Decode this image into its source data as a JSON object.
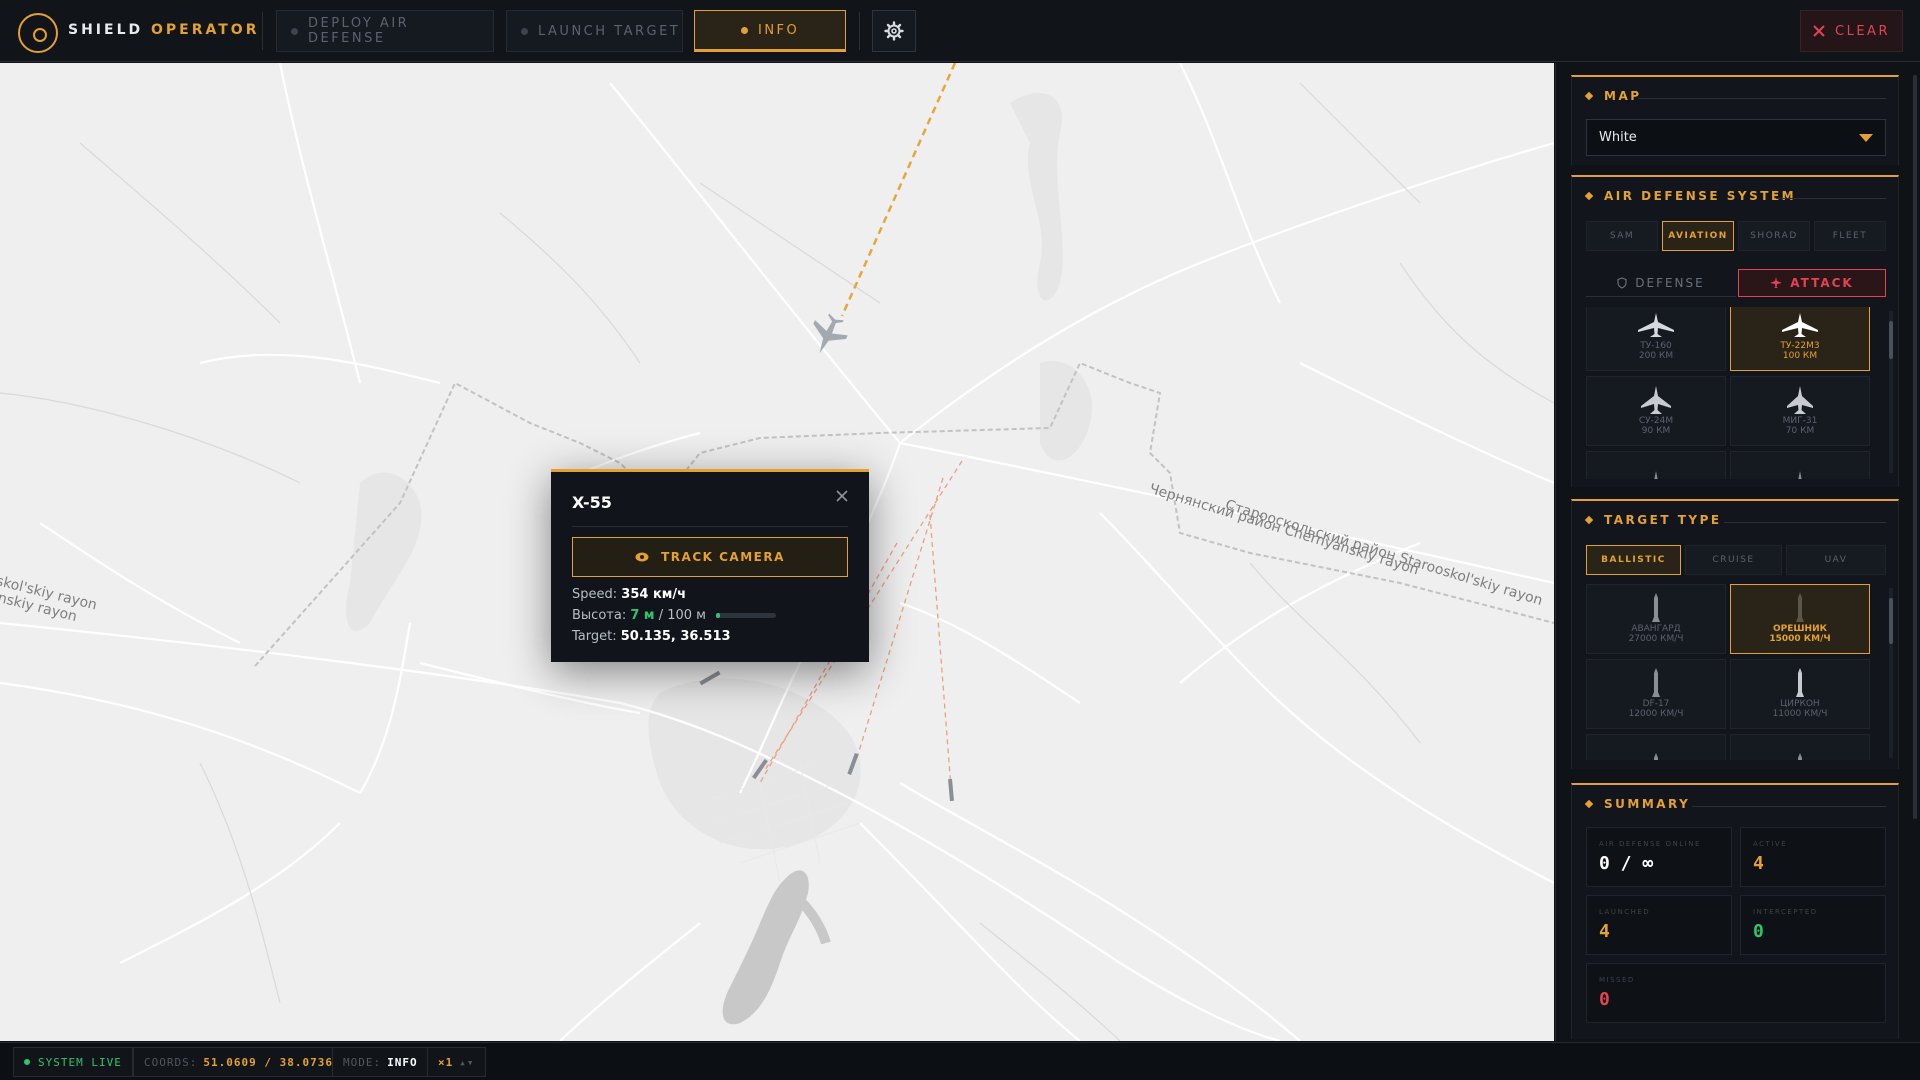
{
  "app": {
    "brand_primary": "SHIELD",
    "brand_secondary": "OPERATOR"
  },
  "toolbar": {
    "tabs": [
      {
        "label": "DEPLOY AIR DEFENSE",
        "active": false
      },
      {
        "label": "LAUNCH TARGET",
        "active": false
      },
      {
        "label": "INFO",
        "active": true
      }
    ],
    "settings_icon": "gear-icon",
    "clear_label": "CLEAR",
    "clear_icon": "close-icon"
  },
  "map": {
    "labels": {
      "left_region": "oskol'skiy rayon",
      "left_region2": "nskiy rayon",
      "right_region": "Старооскольский район Starooskol'skiy rayon",
      "right_region2": "Чернянский район Chernyanskiy rayon"
    }
  },
  "popup": {
    "title": "X-55",
    "close_icon": "close-icon",
    "track_label": "TRACK CAMERA",
    "speed_label": "Speed:",
    "speed_value": "354 км/ч",
    "altitude_label": "Высота:",
    "altitude_value": "7 м",
    "altitude_max": "/ 100 м",
    "altitude_fraction": 0.07,
    "target_label": "Target:",
    "target_value": "50.135, 36.513"
  },
  "panel": {
    "map_section": {
      "title": "MAP",
      "selected": "White"
    },
    "air_defense": {
      "title": "AIR DEFENSE SYSTEM",
      "categories": [
        {
          "label": "SAM",
          "active": false
        },
        {
          "label": "AVIATION",
          "active": true
        },
        {
          "label": "SHORAD",
          "active": false
        },
        {
          "label": "FLEET",
          "active": false
        }
      ],
      "defense_label": "DEFENSE",
      "attack_label": "ATTACK",
      "aircraft": [
        {
          "name": "ТУ-160",
          "range": "200 КМ",
          "active": false
        },
        {
          "name": "ТУ-22М3",
          "range": "100 КМ",
          "active": true
        },
        {
          "name": "СУ-24М",
          "range": "90 КМ",
          "active": false
        },
        {
          "name": "МИГ-31",
          "range": "70 КМ",
          "active": false
        }
      ]
    },
    "target_type": {
      "title": "TARGET TYPE",
      "categories": [
        {
          "label": "BALLISTIC",
          "active": true
        },
        {
          "label": "CRUISE",
          "active": false
        },
        {
          "label": "UAV",
          "active": false
        }
      ],
      "missiles": [
        {
          "name": "АВАНГАРД",
          "speed": "27000 КМ/Ч",
          "active": false
        },
        {
          "name": "ОРЕШНИК",
          "speed": "15000 КМ/Ч",
          "active": true
        },
        {
          "name": "DF-17",
          "speed": "12000 КМ/Ч",
          "active": false
        },
        {
          "name": "ЦИРКОН",
          "speed": "11000 КМ/Ч",
          "active": false
        }
      ]
    },
    "summary": {
      "title": "SUMMARY",
      "air_defense_online_label": "AIR DEFENSE ONLINE",
      "air_defense_online_value": "0 / ∞",
      "active_label": "ACTIVE",
      "active_value": "4",
      "launched_label": "LAUNCHED",
      "launched_value": "4",
      "intercepted_label": "INTERCEPTED",
      "intercepted_value": "0",
      "missed_label": "MISSED",
      "missed_value": "0"
    }
  },
  "statusbar": {
    "system_label": "SYSTEM LIVE",
    "coords_label": "COORDS:",
    "coords_value": "51.0609 / 38.0736",
    "mode_label": "MODE:",
    "mode_value": "INFO",
    "speed_label": "×1"
  },
  "colors": {
    "accent": "#e2a131",
    "danger": "#e2444f",
    "success": "#2ec46d",
    "map_bg": "#efefef"
  }
}
